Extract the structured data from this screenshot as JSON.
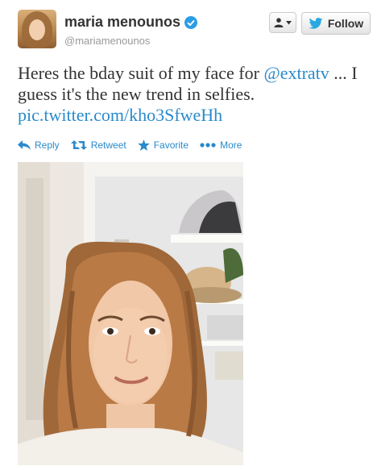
{
  "user": {
    "name": "maria menounos",
    "handle": "@mariamenounos",
    "verified": true
  },
  "buttons": {
    "follow_label": "Follow"
  },
  "tweet": {
    "text_main": "Heres the bday suit of my face for ",
    "mention": "@extratv",
    "text_cont": " ... I guess it's the new trend in selfies.",
    "link": "pic.twitter.com/kho3SfweHh"
  },
  "actions": {
    "reply": "Reply",
    "retweet": "Retweet",
    "favorite": "Favorite",
    "more": "More"
  },
  "colors": {
    "link": "#2a8acb",
    "verified": "#2b9ce6",
    "bird": "#2aa9e0"
  },
  "icons": [
    "person-icon",
    "chevron-down-icon",
    "twitter-bird-icon",
    "verified-badge-icon",
    "reply-icon",
    "retweet-icon",
    "star-icon",
    "more-dots-icon"
  ]
}
